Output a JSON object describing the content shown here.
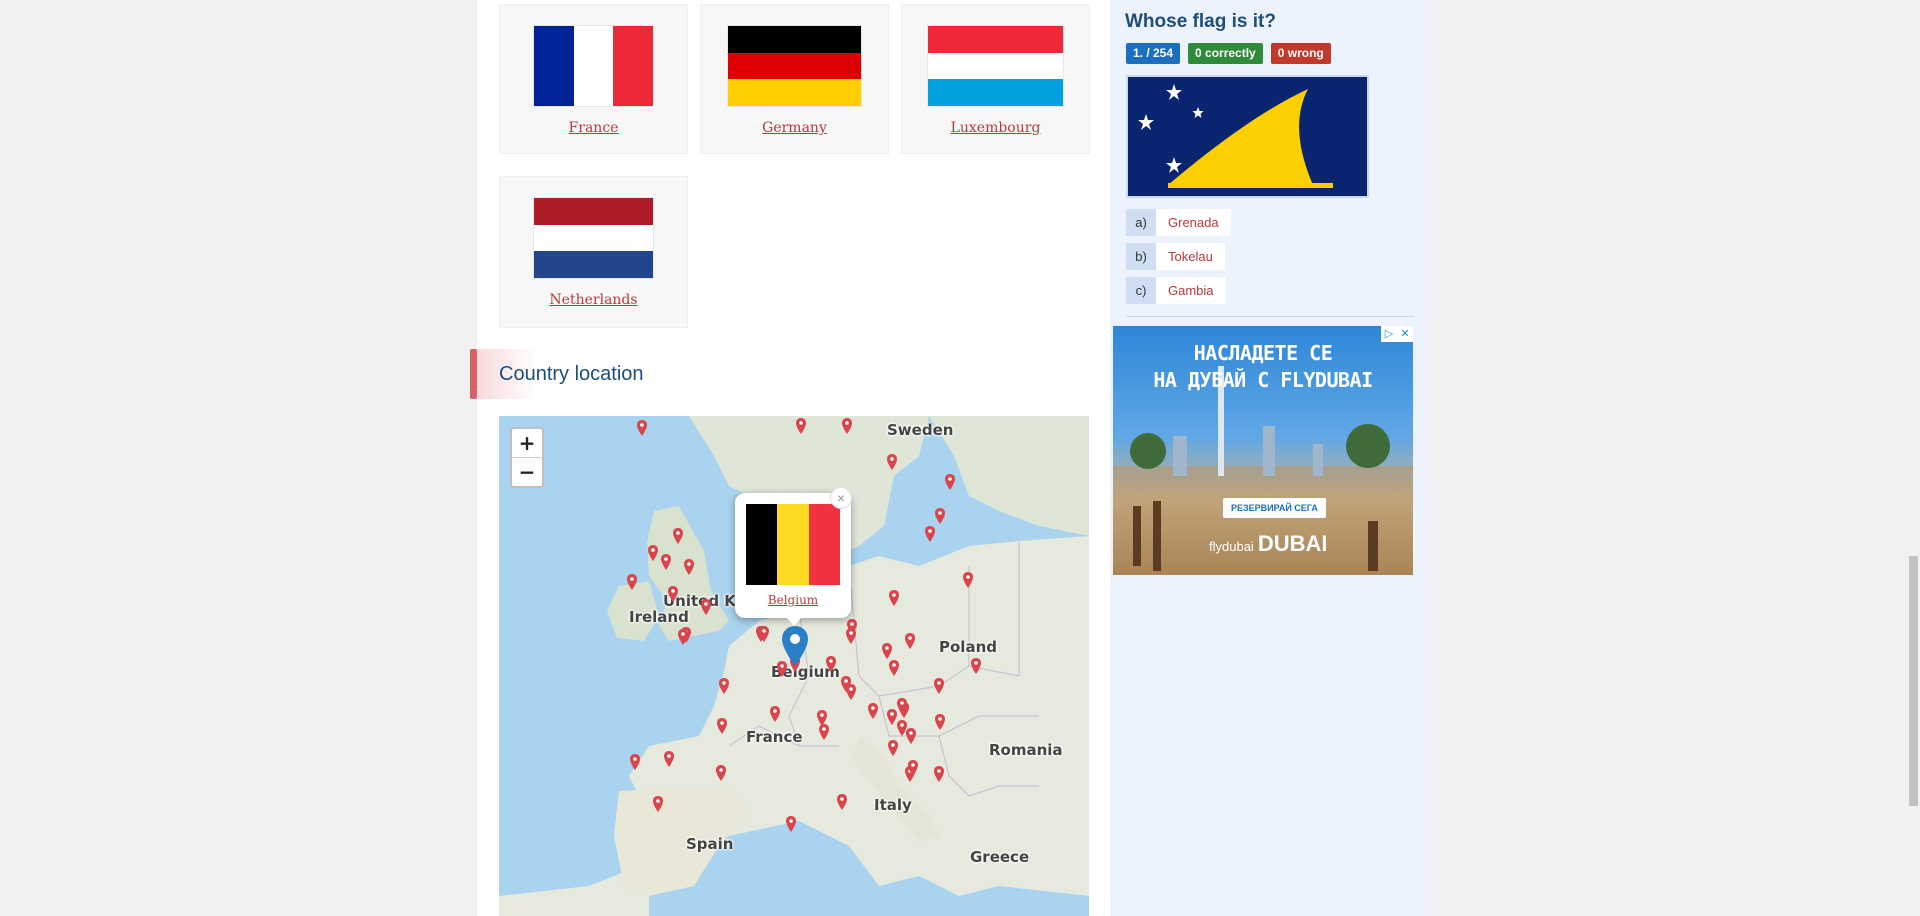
{
  "flags": [
    {
      "name": "France"
    },
    {
      "name": "Germany"
    },
    {
      "name": "Luxembourg"
    },
    {
      "name": "Netherlands"
    }
  ],
  "section": {
    "title": "Country location"
  },
  "map": {
    "zoom_in": "+",
    "zoom_out": "−",
    "labels": {
      "sweden": "Sweden",
      "united_kingdom": "United Ki",
      "ireland": "Ireland",
      "poland": "Poland",
      "belgium": "Belgium",
      "france": "France",
      "romania": "Romania",
      "italy": "Italy",
      "spain": "Spain",
      "greece": "Greece"
    },
    "popup": {
      "country": "Belgium",
      "close": "×"
    }
  },
  "quiz": {
    "title": "Whose flag is it?",
    "progress": "1. / 254",
    "correct": "0 correctly",
    "wrong": "0 wrong",
    "answers": [
      {
        "letter": "a)",
        "option": "Grenada"
      },
      {
        "letter": "b)",
        "option": "Tokelau"
      },
      {
        "letter": "c)",
        "option": "Gambia"
      }
    ]
  },
  "ad": {
    "headline_1": "НАСЛАДЕТЕ СЕ",
    "headline_2": "НА ДУБАЙ С FLYDUBAI",
    "cta": "РЕЗЕРВИРАЙ СЕГА",
    "brand_small": "flydubai",
    "brand_big": "DUBAI"
  },
  "colors": {
    "link_red": "#b83a3a",
    "title_blue": "#1f4d7c",
    "badge_blue": "#1a6fbf",
    "badge_green": "#2f8a3a",
    "badge_red": "#c0392b"
  }
}
